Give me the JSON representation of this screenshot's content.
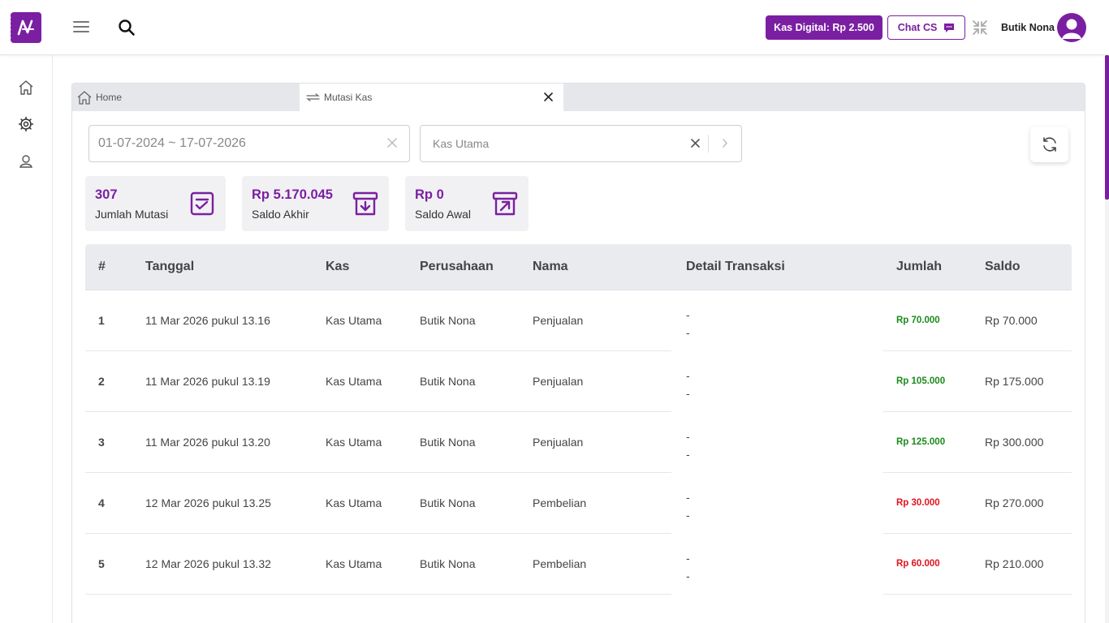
{
  "header": {
    "kas_digital_label": "Kas Digital: Rp 2.500",
    "chat_cs_label": "Chat CS",
    "user_name": "Butik Nona"
  },
  "sidebar": {
    "items": [
      {
        "name": "home-icon"
      },
      {
        "name": "settings-icon"
      },
      {
        "name": "user-icon"
      }
    ]
  },
  "tabs": [
    {
      "label": "Home",
      "icon": "home-icon"
    },
    {
      "label": "Mutasi Kas",
      "icon": "transfer-icon",
      "active": true
    }
  ],
  "filters": {
    "date_range": "01-07-2024 ~ 17-07-2026",
    "kas": "Kas Utama"
  },
  "stats": [
    {
      "value": "307",
      "label": "Jumlah Mutasi",
      "icon": "checklist-icon"
    },
    {
      "value": "Rp 5.170.045",
      "label": "Saldo Akhir",
      "icon": "archive-in-icon"
    },
    {
      "value": "Rp 0",
      "label": "Saldo Awal",
      "icon": "archive-out-icon"
    }
  ],
  "table": {
    "columns": [
      "#",
      "Tanggal",
      "Kas",
      "Perusahaan",
      "Nama",
      "Detail Transaksi",
      "Jumlah",
      "Saldo"
    ],
    "rows": [
      {
        "no": "1",
        "tanggal": "11 Mar 2026 pukul 13.16",
        "kas": "Kas Utama",
        "perusahaan": "Butik Nona",
        "nama": "Penjualan",
        "detail1": "-",
        "detail2": "-",
        "jumlah": "Rp 70.000",
        "type": "in",
        "saldo": "Rp 70.000"
      },
      {
        "no": "2",
        "tanggal": "11 Mar 2026 pukul 13.19",
        "kas": "Kas Utama",
        "perusahaan": "Butik Nona",
        "nama": "Penjualan",
        "detail1": "-",
        "detail2": "-",
        "jumlah": "Rp 105.000",
        "type": "in",
        "saldo": "Rp 175.000"
      },
      {
        "no": "3",
        "tanggal": "11 Mar 2026 pukul 13.20",
        "kas": "Kas Utama",
        "perusahaan": "Butik Nona",
        "nama": "Penjualan",
        "detail1": "-",
        "detail2": "-",
        "jumlah": "Rp 125.000",
        "type": "in",
        "saldo": "Rp 300.000"
      },
      {
        "no": "4",
        "tanggal": "12 Mar 2026 pukul 13.25",
        "kas": "Kas Utama",
        "perusahaan": "Butik Nona",
        "nama": "Pembelian",
        "detail1": "-",
        "detail2": "-",
        "jumlah": "Rp 30.000",
        "type": "out",
        "saldo": "Rp 270.000"
      },
      {
        "no": "5",
        "tanggal": "12 Mar 2026 pukul 13.32",
        "kas": "Kas Utama",
        "perusahaan": "Butik Nona",
        "nama": "Pembelian",
        "detail1": "-",
        "detail2": "-",
        "jumlah": "Rp 60.000",
        "type": "out",
        "saldo": "Rp 210.000"
      }
    ]
  },
  "colors": {
    "brand": "#7b1fa2",
    "amount_in": "#1b8a1b",
    "amount_out": "#e0141e"
  }
}
